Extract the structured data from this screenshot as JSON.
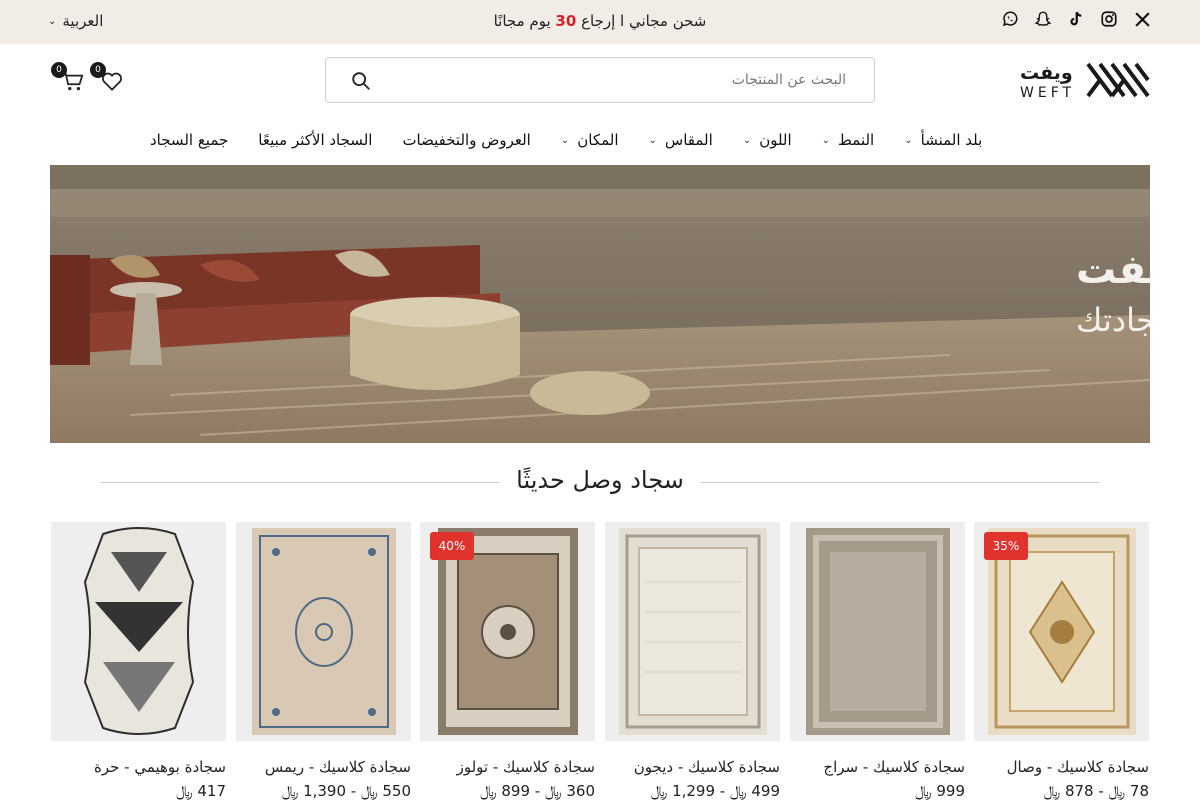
{
  "topbar": {
    "language": "العربية",
    "promo_prefix": "شحن مجاني ا إرجاع",
    "promo_days": "30",
    "promo_suffix": "يوم مجانًا",
    "social_icons": [
      "x-icon",
      "instagram-icon",
      "tiktok-icon",
      "snapchat-icon",
      "whatsapp-icon"
    ]
  },
  "header": {
    "logo_ar": "ويفت",
    "logo_en": "WEFT",
    "search_placeholder": "البحث عن المنتجات",
    "wishlist_count": "0",
    "cart_count": "0"
  },
  "nav": [
    {
      "label": "جميع السجاد",
      "has_menu": false
    },
    {
      "label": "السجاد الأكثر مبيعًا",
      "has_menu": false
    },
    {
      "label": "العروض والتخفيضات",
      "has_menu": false
    },
    {
      "label": "المكان",
      "has_menu": true
    },
    {
      "label": "المقاس",
      "has_menu": true
    },
    {
      "label": "اللون",
      "has_menu": true
    },
    {
      "label": "النمط",
      "has_menu": true
    },
    {
      "label": "بلد المنشأ",
      "has_menu": true
    }
  ],
  "hero": {
    "brand": "ويفت",
    "tagline": "الوجهة الأولى لإختيار سجادتك"
  },
  "section": {
    "title": "سجاد وصل حديثًا"
  },
  "currency_symbol": "﷼",
  "products": [
    {
      "title": "سجادة كلاسيك - وصال",
      "price": "78 ﷼ - 878 ﷼",
      "discount": "35%"
    },
    {
      "title": "سجادة كلاسيك - سراج",
      "price": "999 ﷼",
      "discount": ""
    },
    {
      "title": "سجادة كلاسيك - ديجون",
      "price": "499 ﷼ - 1,299 ﷼",
      "discount": ""
    },
    {
      "title": "سجادة كلاسيك - تولوز",
      "price": "360 ﷼ - 899 ﷼",
      "discount": "40%"
    },
    {
      "title": "سجادة كلاسيك - ريمس",
      "price": "550 ﷼ - 1,390 ﷼",
      "discount": ""
    },
    {
      "title": "سجادة بوهيمي - حرة",
      "price": "417 ﷼",
      "discount": ""
    }
  ],
  "colors": {
    "topbar_bg": "#f1ece6",
    "accent_red": "#d81f26",
    "badge_red": "#e0332e"
  }
}
